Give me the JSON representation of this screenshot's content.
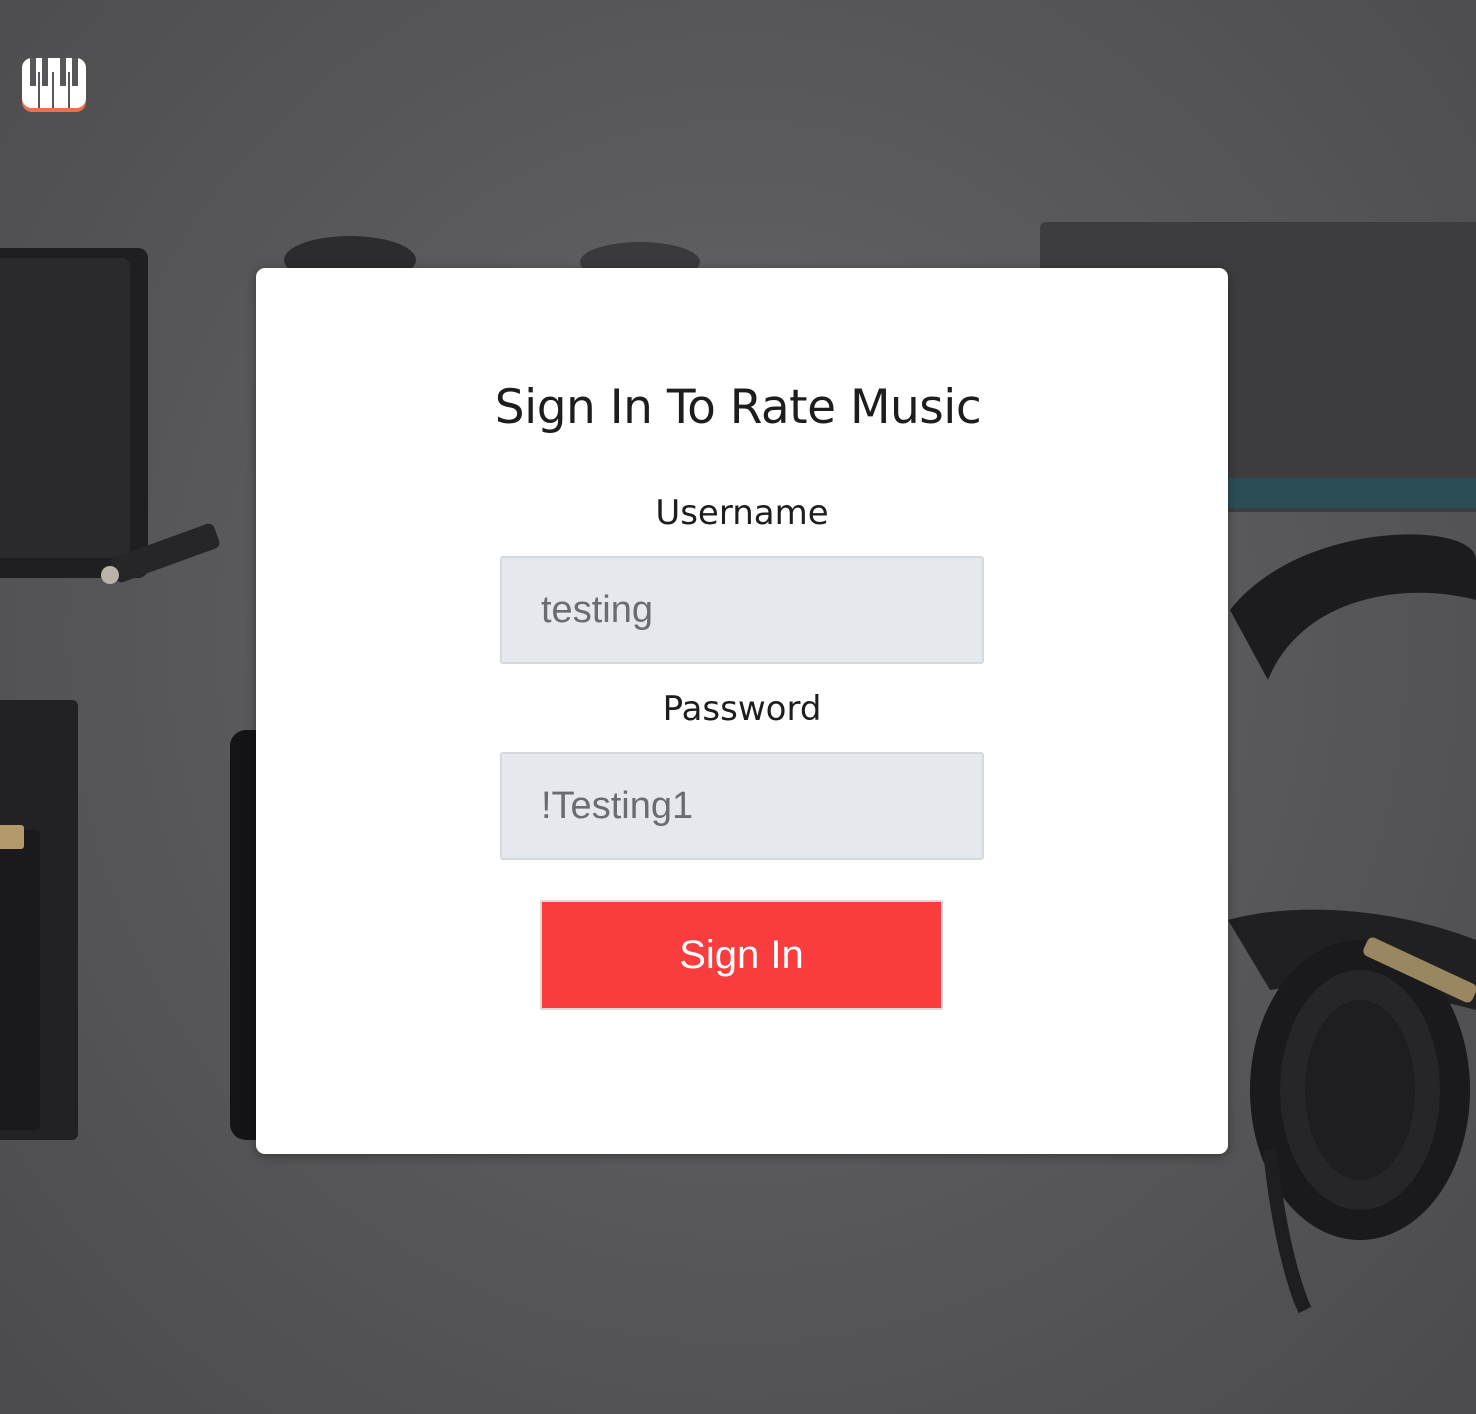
{
  "logo": {
    "icon": "piano-keys-icon"
  },
  "form": {
    "title": "Sign In To Rate Music",
    "username_label": "Username",
    "username_value": "testing",
    "password_label": "Password",
    "password_value": "!Testing1",
    "submit_label": "Sign In"
  },
  "colors": {
    "button": "#f93d3f",
    "field_bg": "#e5e8ec",
    "card_bg": "#ffffff",
    "logo_accent": "#e8734a"
  }
}
